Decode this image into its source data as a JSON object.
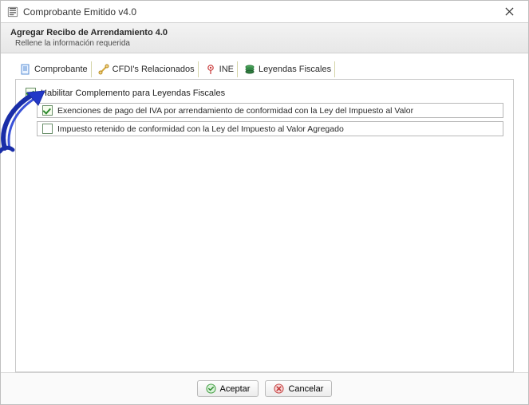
{
  "titlebar": {
    "title": "Comprobante Emitido v4.0"
  },
  "header": {
    "subtitle": "Agregar Recibo de Arrendamiento 4.0",
    "hint": "Rellene la información requerida"
  },
  "tabs": [
    {
      "label": "Comprobante"
    },
    {
      "label": "CFDI's Relacionados"
    },
    {
      "label": "INE"
    },
    {
      "label": "Leyendas Fiscales"
    }
  ],
  "panel": {
    "enable_label": "Habilitar Complemento para Leyendas Fiscales",
    "enable_checked": true,
    "rows": [
      {
        "checked": true,
        "text": "Exenciones de pago del IVA por arrendamiento de conformidad con la Ley del Impuesto al Valor"
      },
      {
        "checked": false,
        "text": "Impuesto retenido de conformidad con la Ley del Impuesto al Valor Agregado"
      }
    ]
  },
  "footer": {
    "accept_label": "Aceptar",
    "cancel_label": "Cancelar"
  }
}
